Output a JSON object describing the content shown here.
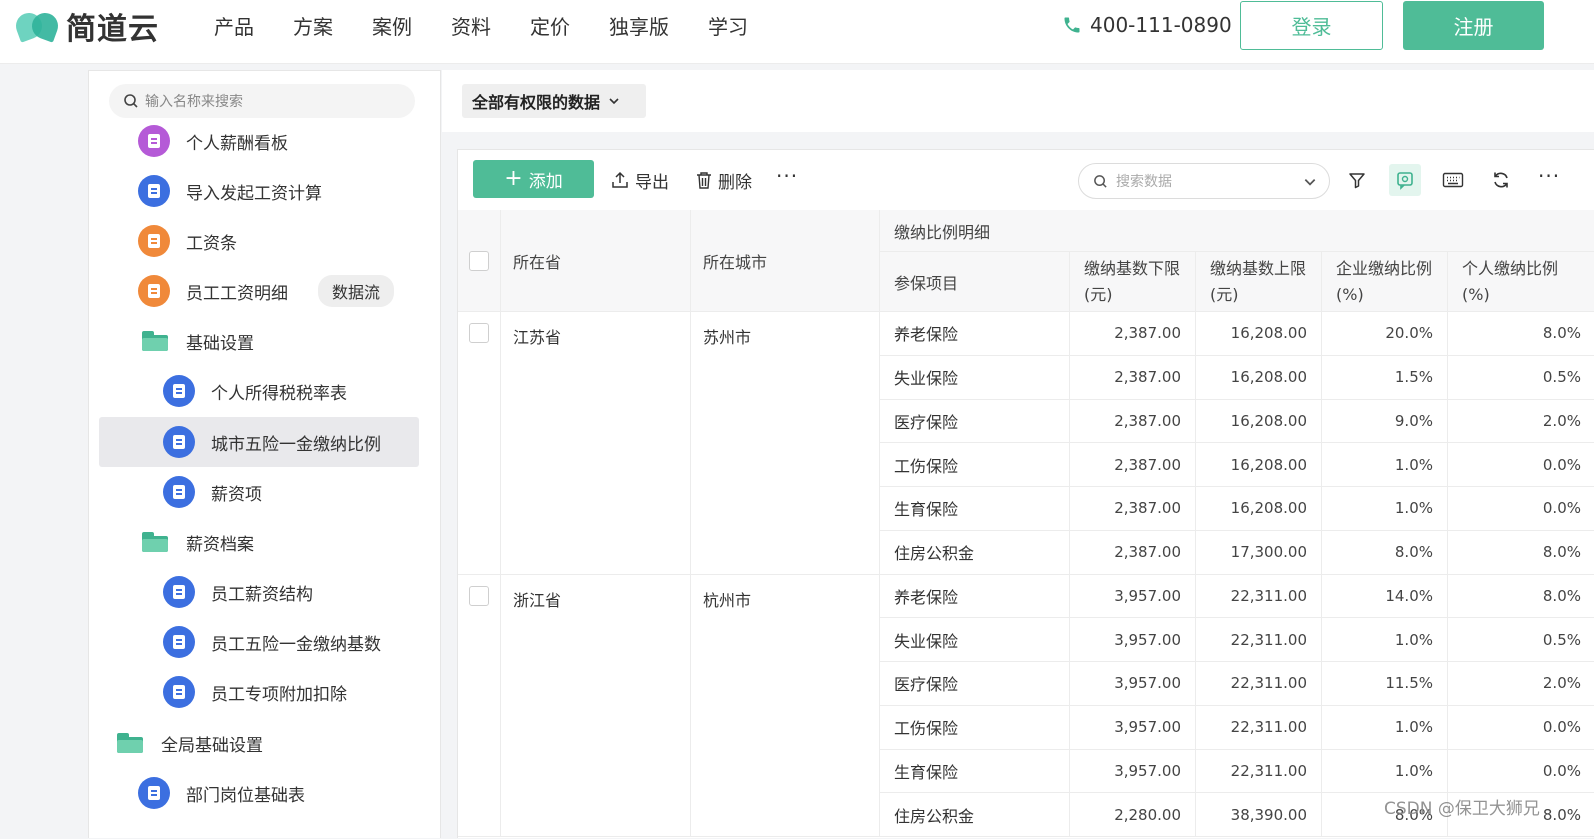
{
  "header": {
    "brand": "简道云",
    "nav": [
      "产品",
      "方案",
      "案例",
      "资料",
      "定价",
      "独享版",
      "学习"
    ],
    "phone": "400-111-0890",
    "login": "登录",
    "register": "注册",
    "accent": "#4fbc97"
  },
  "sidebar": {
    "search_placeholder": "输入名称来搜索",
    "items": [
      {
        "label": "个人薪酬看板",
        "icon": "purple-doc-icon"
      },
      {
        "label": "导入发起工资计算",
        "icon": "blue-doc-icon"
      },
      {
        "label": "工资条",
        "icon": "orange-doc-icon"
      },
      {
        "label": "员工工资明细",
        "icon": "orange-doc-icon",
        "tag": "数据流"
      },
      {
        "label": "基础设置",
        "icon": "folder-icon"
      },
      {
        "label": "个人所得税税率表",
        "icon": "blue-doc-icon"
      },
      {
        "label": "城市五险一金缴纳比例",
        "icon": "blue-doc-icon",
        "active": true
      },
      {
        "label": "薪资项",
        "icon": "blue-doc-icon"
      },
      {
        "label": "薪资档案",
        "icon": "folder-icon"
      },
      {
        "label": "员工薪资结构",
        "icon": "blue-doc-icon"
      },
      {
        "label": "员工五险一金缴纳基数",
        "icon": "blue-doc-icon"
      },
      {
        "label": "员工专项附加扣除",
        "icon": "blue-doc-icon"
      },
      {
        "label": "全局基础设置",
        "icon": "folder-icon"
      },
      {
        "label": "部门岗位基础表",
        "icon": "blue-doc-icon"
      }
    ]
  },
  "main": {
    "view_select": "全部有权限的数据",
    "toolbar": {
      "add": "添加",
      "export": "导出",
      "delete": "删除",
      "more": "···",
      "search_placeholder": "搜索数据"
    },
    "table": {
      "headers": {
        "province": "所在省",
        "city": "所在城市",
        "group": "缴纳比例明细",
        "item": "参保项目",
        "base_low_1": "缴纳基数下限",
        "base_low_2": "(元)",
        "base_high_1": "缴纳基数上限",
        "base_high_2": "(元)",
        "company_rate_1": "企业缴纳比例",
        "company_rate_2": "(%)",
        "personal_rate_1": "个人缴纳比例",
        "personal_rate_2": "(%)"
      },
      "records": [
        {
          "province": "江苏省",
          "city": "苏州市",
          "rows": [
            [
              "养老保险",
              "2,387.00",
              "16,208.00",
              "20.0%",
              "8.0%"
            ],
            [
              "失业保险",
              "2,387.00",
              "16,208.00",
              "1.5%",
              "0.5%"
            ],
            [
              "医疗保险",
              "2,387.00",
              "16,208.00",
              "9.0%",
              "2.0%"
            ],
            [
              "工伤保险",
              "2,387.00",
              "16,208.00",
              "1.0%",
              "0.0%"
            ],
            [
              "生育保险",
              "2,387.00",
              "16,208.00",
              "1.0%",
              "0.0%"
            ],
            [
              "住房公积金",
              "2,387.00",
              "17,300.00",
              "8.0%",
              "8.0%"
            ]
          ]
        },
        {
          "province": "浙江省",
          "city": "杭州市",
          "rows": [
            [
              "养老保险",
              "3,957.00",
              "22,311.00",
              "14.0%",
              "8.0%"
            ],
            [
              "失业保险",
              "3,957.00",
              "22,311.00",
              "1.0%",
              "0.5%"
            ],
            [
              "医疗保险",
              "3,957.00",
              "22,311.00",
              "11.5%",
              "2.0%"
            ],
            [
              "工伤保险",
              "3,957.00",
              "22,311.00",
              "1.0%",
              "0.0%"
            ],
            [
              "生育保险",
              "3,957.00",
              "22,311.00",
              "1.0%",
              "0.0%"
            ],
            [
              "住房公积金",
              "2,280.00",
              "38,390.00",
              "8.0%",
              "8.0%"
            ]
          ]
        }
      ]
    }
  },
  "watermark": "CSDN @保卫大狮兄"
}
